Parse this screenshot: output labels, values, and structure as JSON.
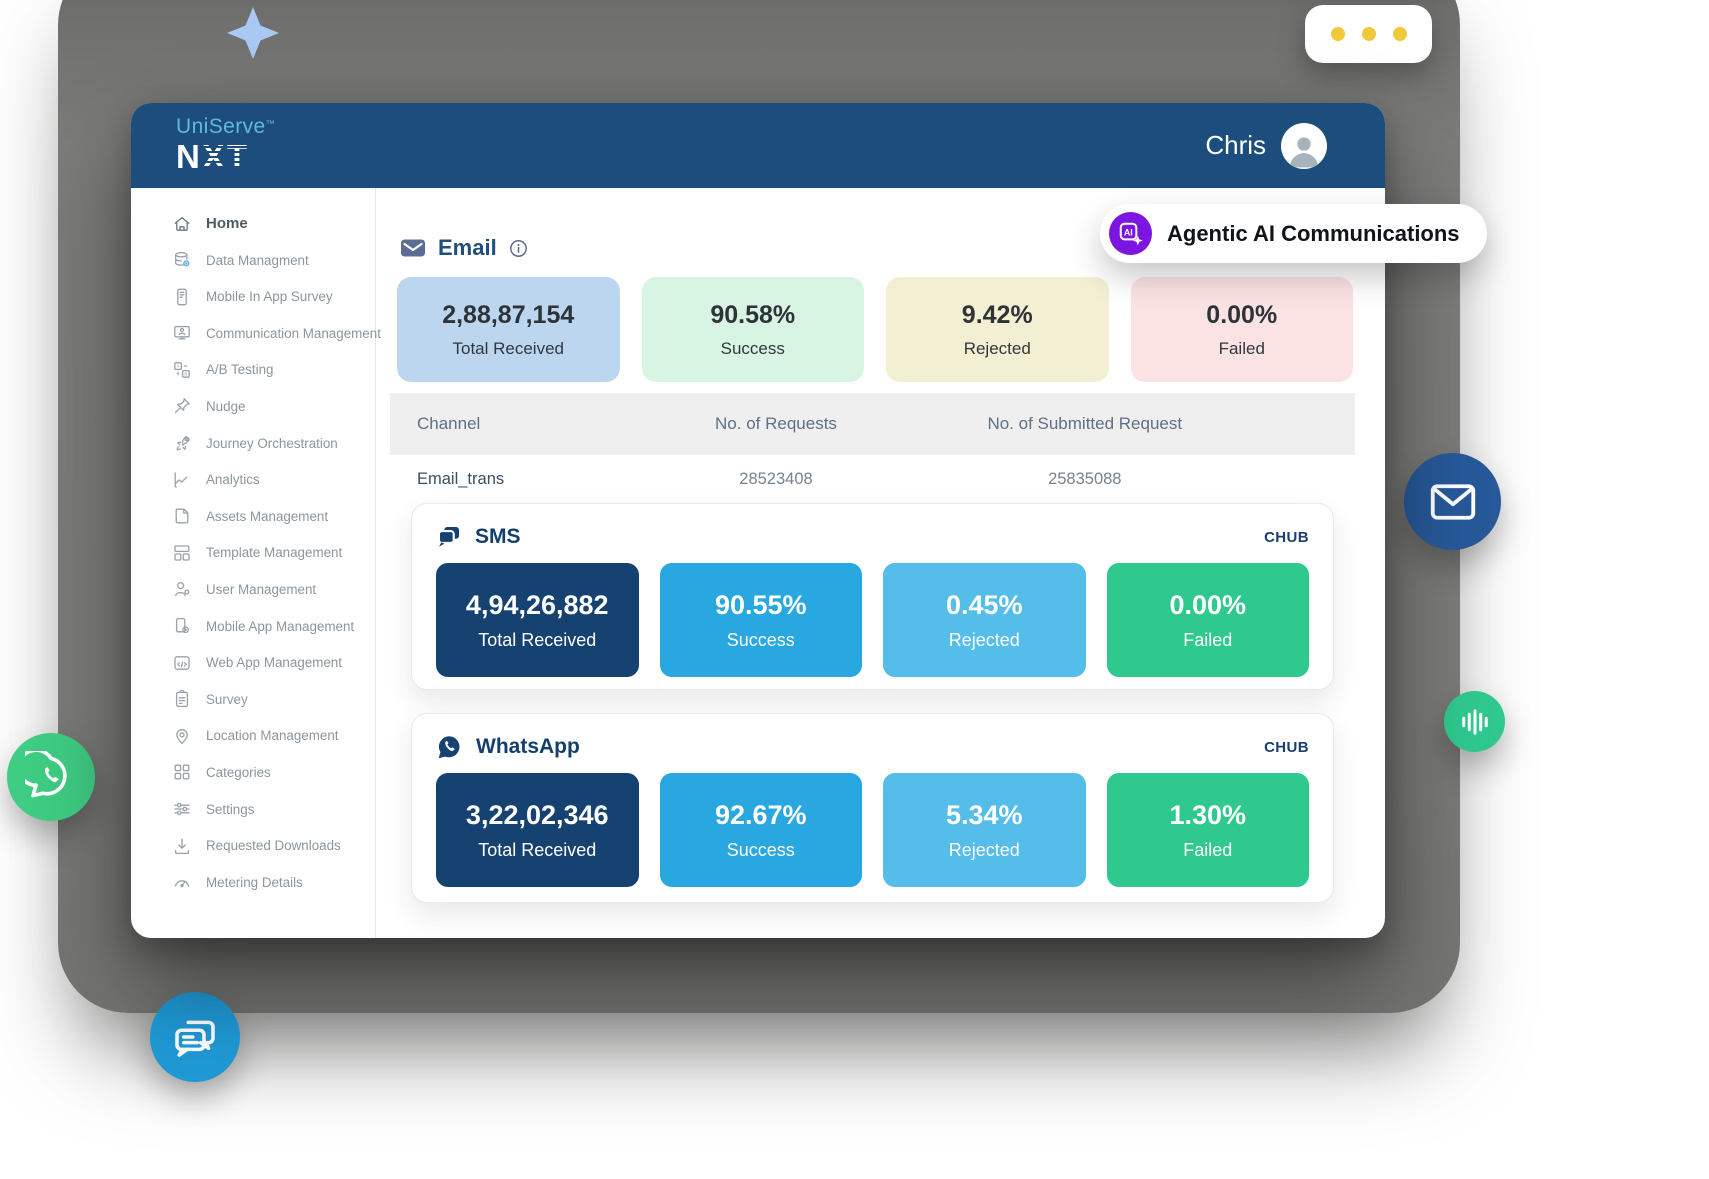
{
  "header": {
    "brand": {
      "line1": "UniServe",
      "tm": "™",
      "line2": "NXT"
    },
    "user": {
      "name": "Chris"
    }
  },
  "promo": {
    "label": "Agentic AI Communications",
    "accent": "#7C15DF"
  },
  "sidebar": {
    "items": [
      {
        "label": "Home",
        "icon": "home-icon",
        "active": true
      },
      {
        "label": "Data Managment",
        "icon": "database-icon"
      },
      {
        "label": "Mobile In App Survey",
        "icon": "mobile-survey-icon"
      },
      {
        "label": "Communication Management",
        "icon": "communication-icon"
      },
      {
        "label": "A/B Testing",
        "icon": "ab-testing-icon"
      },
      {
        "label": "Nudge",
        "icon": "pin-icon"
      },
      {
        "label": "Journey Orchestration",
        "icon": "rocket-icon"
      },
      {
        "label": "Analytics",
        "icon": "analytics-icon"
      },
      {
        "label": "Assets Management",
        "icon": "file-icon"
      },
      {
        "label": "Template Management",
        "icon": "template-icon"
      },
      {
        "label": "User Management",
        "icon": "user-icon"
      },
      {
        "label": "Mobile App Management",
        "icon": "mobile-app-icon"
      },
      {
        "label": "Web App Management",
        "icon": "web-app-icon"
      },
      {
        "label": "Survey",
        "icon": "clipboard-icon"
      },
      {
        "label": "Location Management",
        "icon": "location-icon"
      },
      {
        "label": "Categories",
        "icon": "categories-icon"
      },
      {
        "label": "Settings",
        "icon": "sliders-icon"
      },
      {
        "label": "Requested Downloads",
        "icon": "download-icon"
      },
      {
        "label": "Metering Details",
        "icon": "gauge-icon"
      }
    ]
  },
  "email": {
    "title": "Email",
    "stats": [
      {
        "value": "2,88,87,154",
        "label": "Total Received",
        "bg": "#BDD6F0"
      },
      {
        "value": "90.58%",
        "label": "Success",
        "bg": "#D8F4E2"
      },
      {
        "value": "9.42%",
        "label": "Rejected",
        "bg": "#F2EFD3"
      },
      {
        "value": "0.00%",
        "label": "Failed",
        "bg": "#FBE3E4"
      }
    ],
    "table": {
      "headers": [
        "Channel",
        "No. of Requests",
        "No. of Submitted Request"
      ],
      "rows": [
        {
          "channel": "Email_trans",
          "requests": "28523408",
          "submitted": "25835088"
        }
      ]
    }
  },
  "sms": {
    "title": "SMS",
    "hub": "CHUB",
    "stats": [
      {
        "value": "4,94,26,882",
        "label": "Total Received",
        "bg": "#164272"
      },
      {
        "value": "90.55%",
        "label": "Success",
        "bg": "#29A7E0"
      },
      {
        "value": "0.45%",
        "label": "Rejected",
        "bg": "#55BDEA"
      },
      {
        "value": "0.00%",
        "label": "Failed",
        "bg": "#2FC98F"
      }
    ]
  },
  "whatsapp": {
    "title": "WhatsApp",
    "hub": "CHUB",
    "stats": [
      {
        "value": "3,22,02,346",
        "label": "Total Received",
        "bg": "#164272"
      },
      {
        "value": "92.67%",
        "label": "Success",
        "bg": "#29A7E0"
      },
      {
        "value": "5.34%",
        "label": "Rejected",
        "bg": "#55BDEA"
      },
      {
        "value": "1.30%",
        "label": "Failed",
        "bg": "#2FC98F"
      }
    ]
  },
  "decor": {
    "window_dots_count": 3,
    "floating_icons": [
      "whatsapp-icon",
      "mail-icon",
      "audio-wave-icon",
      "chat-icon",
      "diamond-sparkle"
    ],
    "colors": {
      "header_navy": "#1D4D7C",
      "brand_light_blue": "#5FB9DE",
      "accent_purple": "#7C15DF",
      "navy_card": "#164272",
      "success_blue": "#29A7E0",
      "rejected_blue": "#55BDEA",
      "failed_green": "#2FC98F",
      "whatsapp_green": "#3FCD83",
      "chat_blue": "#1F9AD7",
      "mail_blue": "#27599A",
      "dot_yellow": "#EFC83C",
      "diamond_blue": "#A9C8F3"
    }
  }
}
